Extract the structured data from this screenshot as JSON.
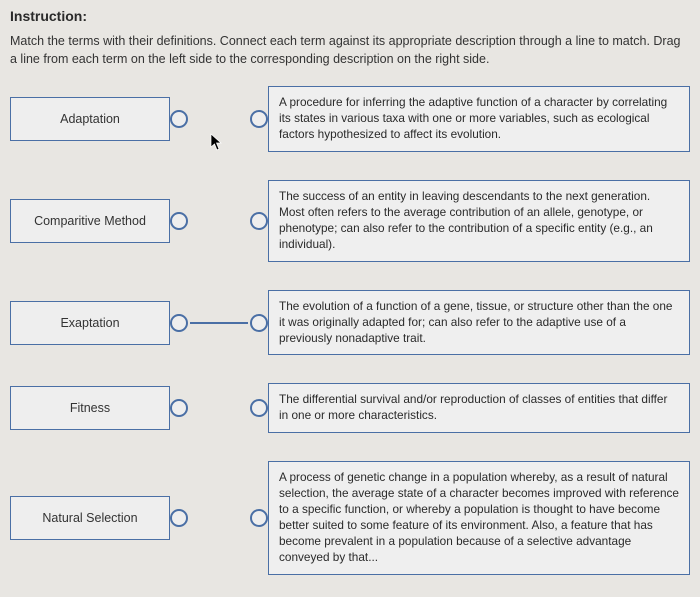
{
  "heading": "Instruction:",
  "instruction": "Match the terms with their definitions. Connect each term against its appropriate description through a line to match. Drag a line from each term on the left side to the corresponding description on the right side.",
  "rows": [
    {
      "term": "Adaptation",
      "definition": "A procedure for inferring the adaptive function of a character by correlating its states in various taxa with one or more variables, such as ecological factors hypothesized to affect its evolution.",
      "connected": false
    },
    {
      "term": "Comparitive Method",
      "definition": "The success of an entity in leaving descendants to the next generation. Most often refers to the average contribution of an allele, genotype, or phenotype; can also refer to the contribution of a specific entity (e.g., an individual).",
      "connected": false
    },
    {
      "term": "Exaptation",
      "definition": "The evolution of a function of a gene, tissue, or structure other than the one it was originally adapted for; can also refer to the adaptive use of a previously nonadaptive trait.",
      "connected": true
    },
    {
      "term": "Fitness",
      "definition": "The differential survival and/or reproduction of classes of entities that differ in one or more characteristics.",
      "connected": false
    },
    {
      "term": "Natural Selection",
      "definition": "A process of genetic change in a population whereby, as a result of natural selection, the average state of a character becomes improved with reference to a specific function, or whereby a population is thought to have become better suited to some feature of its environment. Also, a feature that has become prevalent in a population because of a selective advantage conveyed by that...",
      "connected": false
    }
  ]
}
